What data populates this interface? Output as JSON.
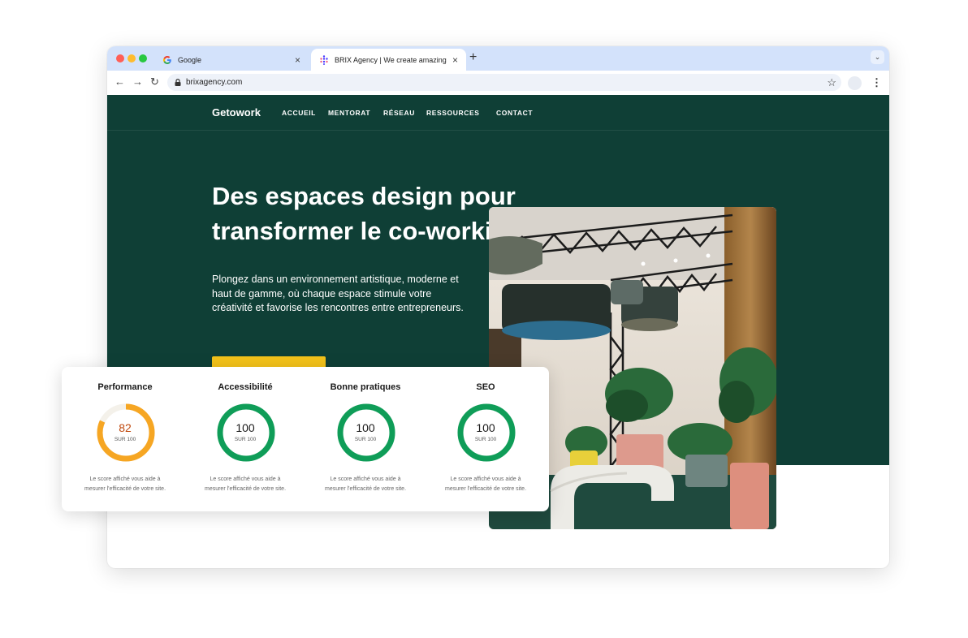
{
  "browser": {
    "tabs": [
      {
        "title": "Google",
        "close": "×"
      },
      {
        "title": "BRIX Agency | We create amazing w",
        "close": "×"
      }
    ],
    "new_tab": "+",
    "url": "brixagency.com"
  },
  "site": {
    "logo": "Getowork",
    "nav": [
      "ACCUEIL",
      "MENTORAT",
      "RÉSEAU",
      "RESSOURCES",
      "CONTACT"
    ],
    "hero_title_line1": "Des espaces design pour",
    "hero_title_line2": "transformer le co-working.",
    "hero_text": "Plongez dans un environnement artistique, moderne et haut de gamme, où chaque espace stimule votre créativité et favorise les rencontres entre entrepreneurs.",
    "colors": {
      "background": "#0f3f36",
      "cta": "#f3c21a"
    }
  },
  "scores": [
    {
      "label": "Performance",
      "value": "82",
      "score": 82,
      "sur": "SUR 100",
      "caption1": "Le score affiché vous aide à",
      "caption2": "mesurer l'efficacité de votre site.",
      "color": "#f6a623"
    },
    {
      "label": "Accessibilité",
      "value": "100",
      "score": 100,
      "sur": "SUR 100",
      "caption1": "Le score affiché vous aide à",
      "caption2": "mesurer l'efficacité de votre site.",
      "color": "#0f9d58"
    },
    {
      "label": "Bonne pratiques",
      "value": "100",
      "score": 100,
      "sur": "SUR 100",
      "caption1": "Le score affiché vous aide à",
      "caption2": "mesurer l'efficacité de votre site.",
      "color": "#0f9d58"
    },
    {
      "label": "SEO",
      "value": "100",
      "score": 100,
      "sur": "SUR 100",
      "caption1": "Le score affiché vous aide à",
      "caption2": "mesurer l'efficacité de votre site.",
      "color": "#0f9d58"
    }
  ]
}
